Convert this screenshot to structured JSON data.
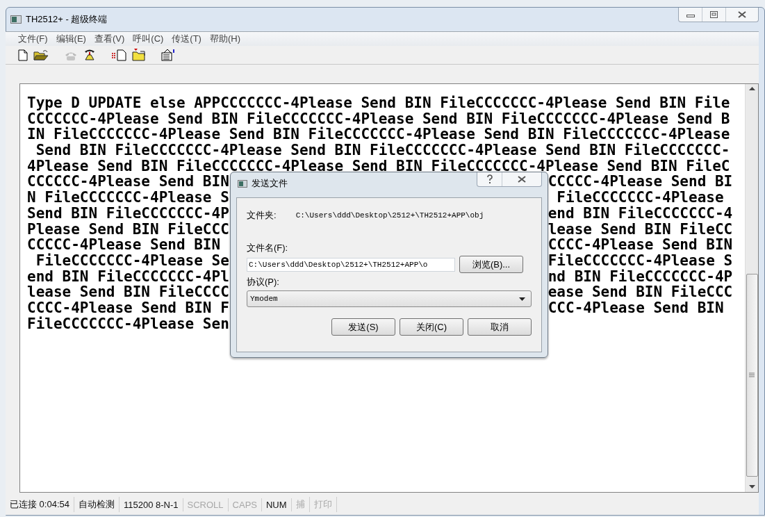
{
  "window": {
    "title": "TH2512+ - 超级终端"
  },
  "menu": [
    "文件(F)",
    "编辑(E)",
    "查看(V)",
    "呼叫(C)",
    "传送(T)",
    "帮助(H)"
  ],
  "toolbar": [
    {
      "kind": "new",
      "disabled": false
    },
    {
      "kind": "open",
      "disabled": false
    },
    {
      "kind": "phone",
      "disabled": true
    },
    {
      "kind": "dial",
      "disabled": false
    },
    {
      "kind": "send",
      "disabled": false
    },
    {
      "kind": "receive",
      "disabled": false
    },
    {
      "kind": "properties",
      "disabled": false
    }
  ],
  "terminal": {
    "lines": [
      {
        "text": "Type D UPDATE else APPCCCCCCC-4Please Send BIN FileCCCCCCC-4Please Send BIN File"
      },
      {
        "text": "CCCCCCC-4Please Send BIN FileCCCCCCC-4Please Send BIN FileCCCCCCC-4Please Send B"
      },
      {
        "text": "IN FileCCCCCCC-4Please Send BIN FileCCCCCCC-4Please Send BIN FileCCCCCCC-4Please"
      },
      {
        "text": " Send BIN FileCCCCCCC-4Please Send BIN FileCCCCCCC-4Please Send BIN FileCCCCCCC-"
      },
      {
        "text": "4Please Send BIN FileCCCCCCC-4Please Send BIN FileCCCCCCC-4Please Send BIN FileC"
      },
      {
        "left": "CCCCCC-4Please Send BIN",
        "right": "CCCCC-4Please Send BI"
      },
      {
        "left": "N FileCCCCCCC-4Please S",
        "right": " FileCCCCCCC-4Please"
      },
      {
        "left": "Send BIN FileCCCCCCC-4P",
        "right": "end BIN FileCCCCCCC-4"
      },
      {
        "left": "Please Send BIN FileCCC",
        "right": "lease Send BIN FileCC"
      },
      {
        "left": "CCCCC-4Please Send BIN",
        "right": "CCCC-4Please Send BIN"
      },
      {
        "left": " FileCCCCCCC-4Please Se",
        "right": "FileCCCCCCC-4Please S"
      },
      {
        "left": "end BIN FileCCCCCCC-4Pl",
        "right": "nd BIN FileCCCCCCC-4P"
      },
      {
        "left": "lease Send BIN FileCCCC",
        "right": "ease Send BIN FileCCC"
      },
      {
        "left": "CCCC-4Please Send BIN F",
        "right": "CCC-4Please Send BIN"
      },
      {
        "left": "FileCCCCCCC-4Please Sen"
      }
    ]
  },
  "dialog": {
    "title": "发送文件",
    "folder_label": "文件夹:",
    "folder": "C:\\Users\\ddd\\Desktop\\2512+\\TH2512+APP\\obj",
    "filename_label": "文件名(F):",
    "filename": "C:\\Users\\ddd\\Desktop\\2512+\\TH2512+APP\\o",
    "browse": "浏览(B)...",
    "protocol_label": "协议(P):",
    "protocol": "Ymodem",
    "buttons": [
      "发送(S)",
      "关闭(C)",
      "取消"
    ]
  },
  "status_bar": [
    {
      "text": "已连接 0:04:54",
      "on": true
    },
    {
      "text": "自动检测",
      "on": true
    },
    {
      "text": "115200 8-N-1",
      "on": true
    },
    {
      "text": "SCROLL",
      "on": false
    },
    {
      "text": "CAPS",
      "on": false
    },
    {
      "text": "NUM",
      "on": true
    },
    {
      "text": "捕",
      "on": false
    },
    {
      "text": "打印",
      "on": false
    }
  ]
}
